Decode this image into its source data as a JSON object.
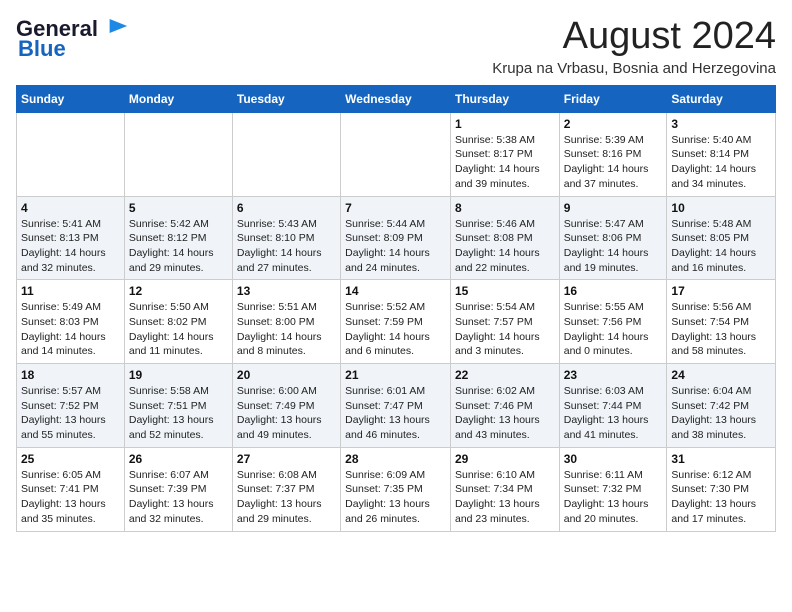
{
  "logo": {
    "line1": "General",
    "line2": "Blue"
  },
  "title": "August 2024",
  "subtitle": "Krupa na Vrbasu, Bosnia and Herzegovina",
  "weekdays": [
    "Sunday",
    "Monday",
    "Tuesday",
    "Wednesday",
    "Thursday",
    "Friday",
    "Saturday"
  ],
  "weeks": [
    [
      {
        "day": "",
        "info": ""
      },
      {
        "day": "",
        "info": ""
      },
      {
        "day": "",
        "info": ""
      },
      {
        "day": "",
        "info": ""
      },
      {
        "day": "1",
        "info": "Sunrise: 5:38 AM\nSunset: 8:17 PM\nDaylight: 14 hours\nand 39 minutes."
      },
      {
        "day": "2",
        "info": "Sunrise: 5:39 AM\nSunset: 8:16 PM\nDaylight: 14 hours\nand 37 minutes."
      },
      {
        "day": "3",
        "info": "Sunrise: 5:40 AM\nSunset: 8:14 PM\nDaylight: 14 hours\nand 34 minutes."
      }
    ],
    [
      {
        "day": "4",
        "info": "Sunrise: 5:41 AM\nSunset: 8:13 PM\nDaylight: 14 hours\nand 32 minutes."
      },
      {
        "day": "5",
        "info": "Sunrise: 5:42 AM\nSunset: 8:12 PM\nDaylight: 14 hours\nand 29 minutes."
      },
      {
        "day": "6",
        "info": "Sunrise: 5:43 AM\nSunset: 8:10 PM\nDaylight: 14 hours\nand 27 minutes."
      },
      {
        "day": "7",
        "info": "Sunrise: 5:44 AM\nSunset: 8:09 PM\nDaylight: 14 hours\nand 24 minutes."
      },
      {
        "day": "8",
        "info": "Sunrise: 5:46 AM\nSunset: 8:08 PM\nDaylight: 14 hours\nand 22 minutes."
      },
      {
        "day": "9",
        "info": "Sunrise: 5:47 AM\nSunset: 8:06 PM\nDaylight: 14 hours\nand 19 minutes."
      },
      {
        "day": "10",
        "info": "Sunrise: 5:48 AM\nSunset: 8:05 PM\nDaylight: 14 hours\nand 16 minutes."
      }
    ],
    [
      {
        "day": "11",
        "info": "Sunrise: 5:49 AM\nSunset: 8:03 PM\nDaylight: 14 hours\nand 14 minutes."
      },
      {
        "day": "12",
        "info": "Sunrise: 5:50 AM\nSunset: 8:02 PM\nDaylight: 14 hours\nand 11 minutes."
      },
      {
        "day": "13",
        "info": "Sunrise: 5:51 AM\nSunset: 8:00 PM\nDaylight: 14 hours\nand 8 minutes."
      },
      {
        "day": "14",
        "info": "Sunrise: 5:52 AM\nSunset: 7:59 PM\nDaylight: 14 hours\nand 6 minutes."
      },
      {
        "day": "15",
        "info": "Sunrise: 5:54 AM\nSunset: 7:57 PM\nDaylight: 14 hours\nand 3 minutes."
      },
      {
        "day": "16",
        "info": "Sunrise: 5:55 AM\nSunset: 7:56 PM\nDaylight: 14 hours\nand 0 minutes."
      },
      {
        "day": "17",
        "info": "Sunrise: 5:56 AM\nSunset: 7:54 PM\nDaylight: 13 hours\nand 58 minutes."
      }
    ],
    [
      {
        "day": "18",
        "info": "Sunrise: 5:57 AM\nSunset: 7:52 PM\nDaylight: 13 hours\nand 55 minutes."
      },
      {
        "day": "19",
        "info": "Sunrise: 5:58 AM\nSunset: 7:51 PM\nDaylight: 13 hours\nand 52 minutes."
      },
      {
        "day": "20",
        "info": "Sunrise: 6:00 AM\nSunset: 7:49 PM\nDaylight: 13 hours\nand 49 minutes."
      },
      {
        "day": "21",
        "info": "Sunrise: 6:01 AM\nSunset: 7:47 PM\nDaylight: 13 hours\nand 46 minutes."
      },
      {
        "day": "22",
        "info": "Sunrise: 6:02 AM\nSunset: 7:46 PM\nDaylight: 13 hours\nand 43 minutes."
      },
      {
        "day": "23",
        "info": "Sunrise: 6:03 AM\nSunset: 7:44 PM\nDaylight: 13 hours\nand 41 minutes."
      },
      {
        "day": "24",
        "info": "Sunrise: 6:04 AM\nSunset: 7:42 PM\nDaylight: 13 hours\nand 38 minutes."
      }
    ],
    [
      {
        "day": "25",
        "info": "Sunrise: 6:05 AM\nSunset: 7:41 PM\nDaylight: 13 hours\nand 35 minutes."
      },
      {
        "day": "26",
        "info": "Sunrise: 6:07 AM\nSunset: 7:39 PM\nDaylight: 13 hours\nand 32 minutes."
      },
      {
        "day": "27",
        "info": "Sunrise: 6:08 AM\nSunset: 7:37 PM\nDaylight: 13 hours\nand 29 minutes."
      },
      {
        "day": "28",
        "info": "Sunrise: 6:09 AM\nSunset: 7:35 PM\nDaylight: 13 hours\nand 26 minutes."
      },
      {
        "day": "29",
        "info": "Sunrise: 6:10 AM\nSunset: 7:34 PM\nDaylight: 13 hours\nand 23 minutes."
      },
      {
        "day": "30",
        "info": "Sunrise: 6:11 AM\nSunset: 7:32 PM\nDaylight: 13 hours\nand 20 minutes."
      },
      {
        "day": "31",
        "info": "Sunrise: 6:12 AM\nSunset: 7:30 PM\nDaylight: 13 hours\nand 17 minutes."
      }
    ]
  ]
}
